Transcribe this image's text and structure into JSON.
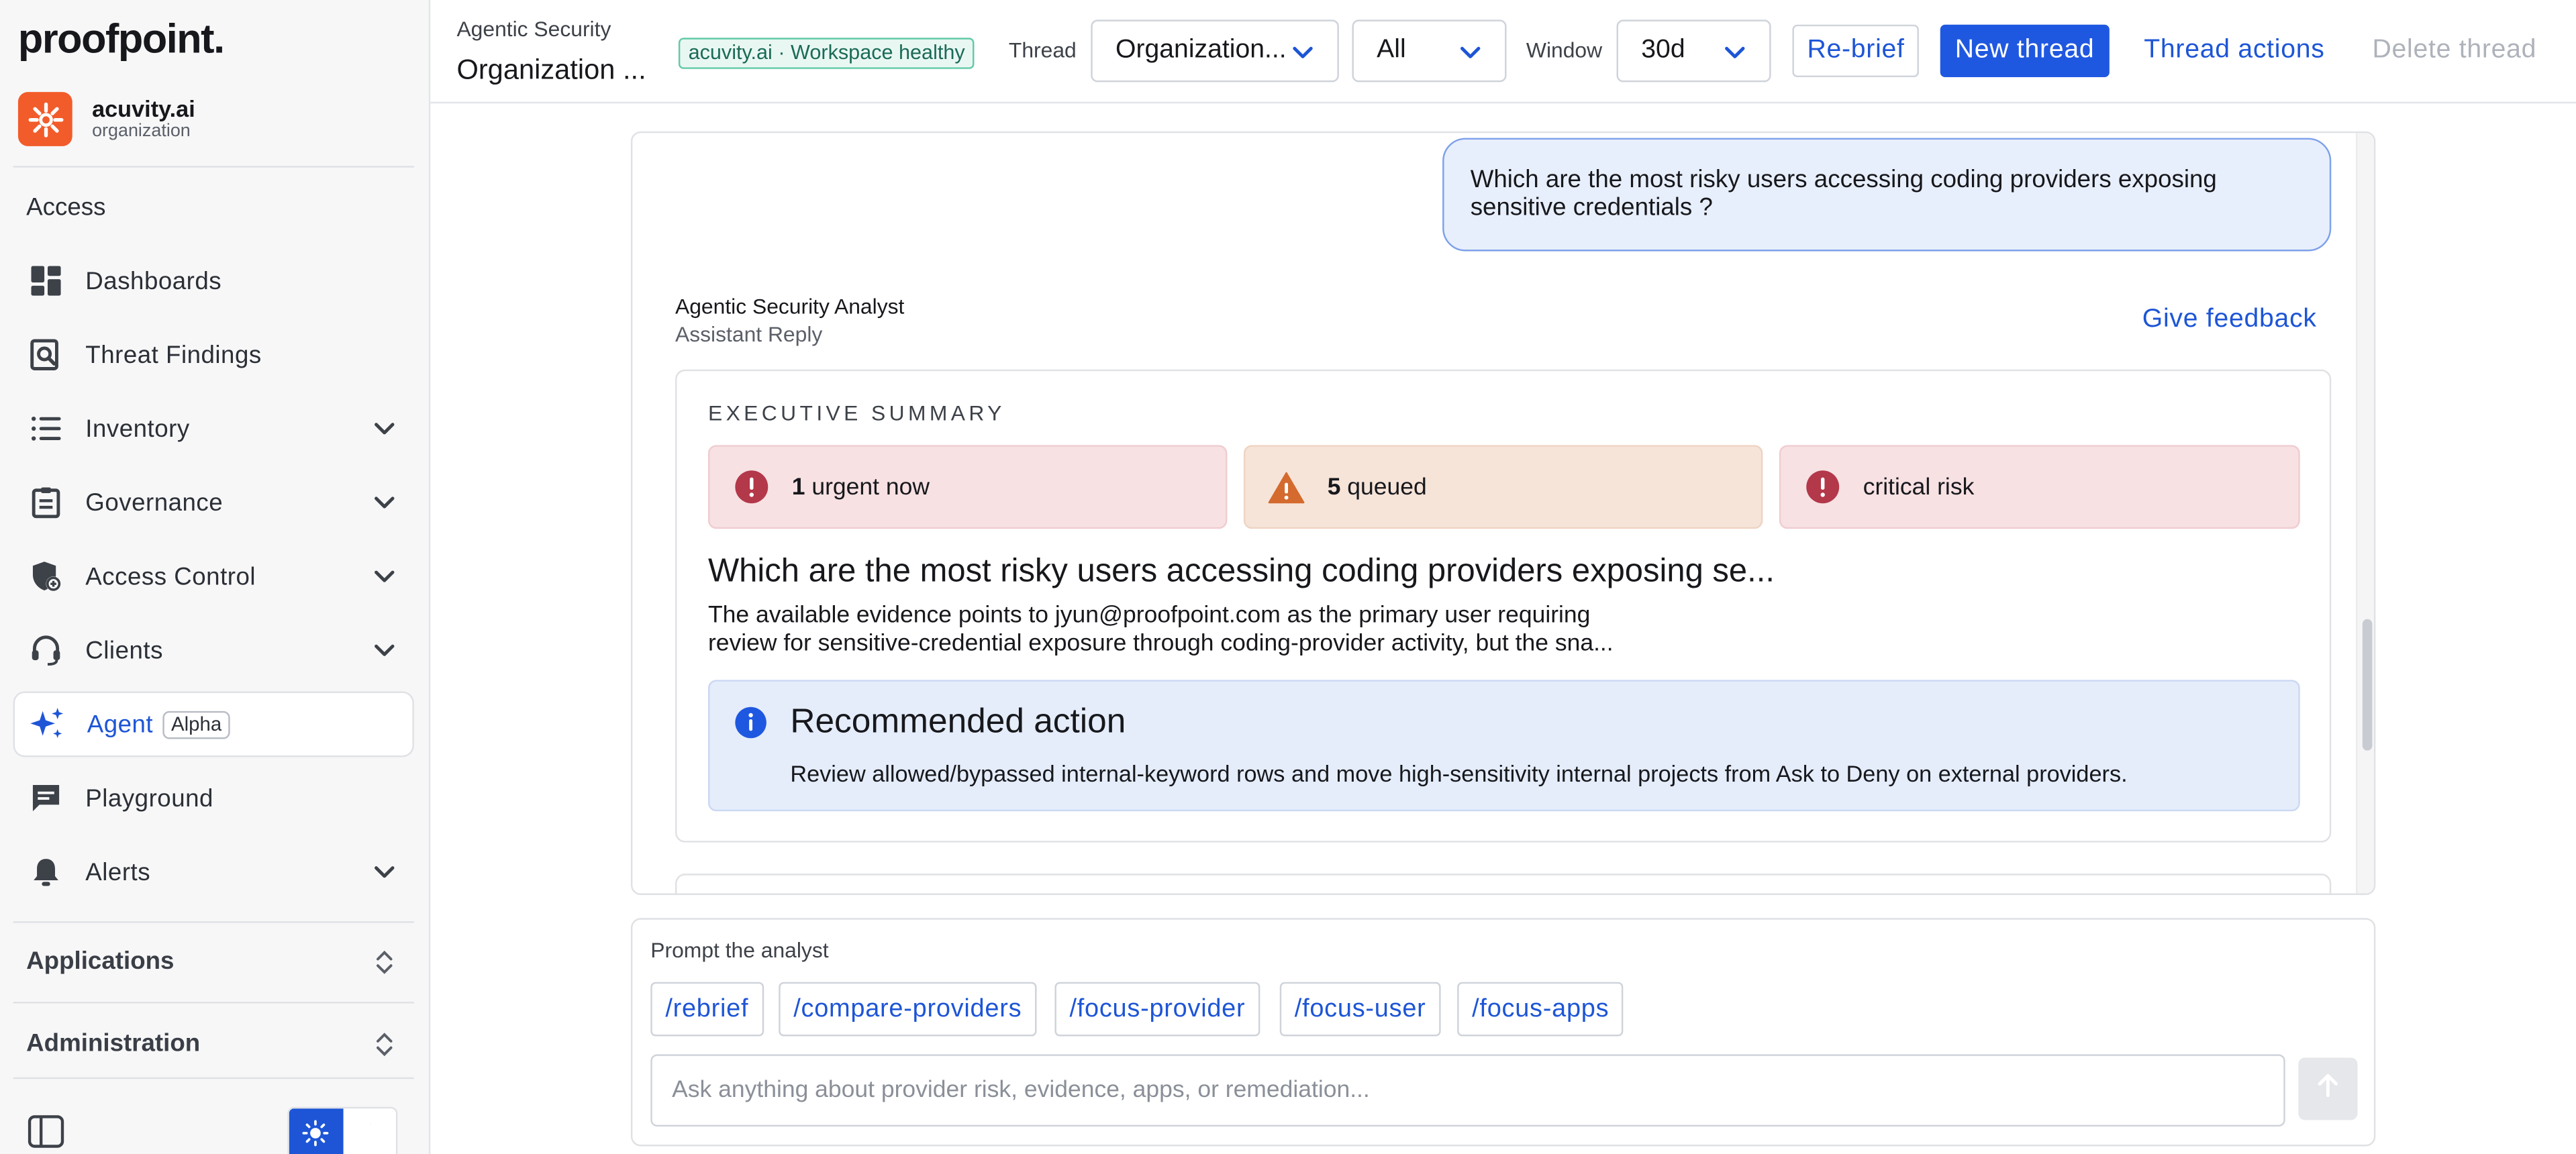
{
  "brand": {
    "logo_text": "proofpoint."
  },
  "org": {
    "name": "acuvity.ai",
    "role": "organization",
    "accent": "#f25c2a"
  },
  "sidebar": {
    "access_heading": "Access",
    "items": [
      {
        "label": "Dashboards",
        "icon": "dashboard-icon"
      },
      {
        "label": "Threat Findings",
        "icon": "threat-findings-icon"
      },
      {
        "label": "Inventory",
        "icon": "list-icon",
        "expandable": true
      },
      {
        "label": "Governance",
        "icon": "clipboard-icon",
        "expandable": true
      },
      {
        "label": "Access Control",
        "icon": "shield-icon",
        "expandable": true
      },
      {
        "label": "Clients",
        "icon": "headset-icon",
        "expandable": true
      },
      {
        "label": "Agent",
        "icon": "sparkle-icon",
        "badge": "Alpha",
        "active": true
      },
      {
        "label": "Playground",
        "icon": "chat-icon"
      },
      {
        "label": "Alerts",
        "icon": "bell-icon",
        "expandable": true
      }
    ],
    "applications_heading": "Applications",
    "administration_heading": "Administration",
    "theme": "light"
  },
  "header": {
    "overline": "Agentic Security",
    "title": "Organization ...",
    "health_badge": "acuvity.ai · Workspace healthy",
    "thread_label": "Thread",
    "thread_value": "Organization...",
    "filter_value": "All",
    "window_label": "Window",
    "window_value": "30d",
    "rebrief_label": "Re-brief",
    "new_thread_label": "New thread",
    "thread_actions_label": "Thread actions",
    "delete_thread_label": "Delete thread",
    "accent": "#1f58e0"
  },
  "thread": {
    "user_message": "Which are the most risky users accessing coding providers exposing sensitive credentials ?",
    "reply_author": "Agentic Security Analyst",
    "reply_type": "Assistant Reply",
    "feedback_label": "Give feedback",
    "summary": {
      "heading": "EXECUTIVE SUMMARY",
      "chips": [
        {
          "count": "1",
          "text": "urgent now",
          "tone": "red",
          "icon": "alert-circle-icon"
        },
        {
          "count": "5",
          "text": "queued",
          "tone": "orange",
          "icon": "warning-triangle-icon"
        },
        {
          "count": "",
          "text": "critical risk",
          "tone": "red",
          "icon": "alert-circle-icon"
        }
      ],
      "title": "Which are the most risky users accessing coding providers exposing se...",
      "body_line1": "The available evidence points to jyun@proofpoint.com as the primary user requiring",
      "body_line2": "review for sensitive-credential exposure through coding-provider activity, but the sna...",
      "recommendation": {
        "title": "Recommended action",
        "text": "Review allowed/bypassed internal-keyword rows and move high-sensitivity internal projects from Ask to Deny on external providers."
      }
    }
  },
  "prompt": {
    "label": "Prompt the analyst",
    "commands": [
      "/rebrief",
      "/compare-providers",
      "/focus-provider",
      "/focus-user",
      "/focus-apps"
    ],
    "placeholder": "Ask anything about provider risk, evidence, apps, or remediation...",
    "value": ""
  }
}
